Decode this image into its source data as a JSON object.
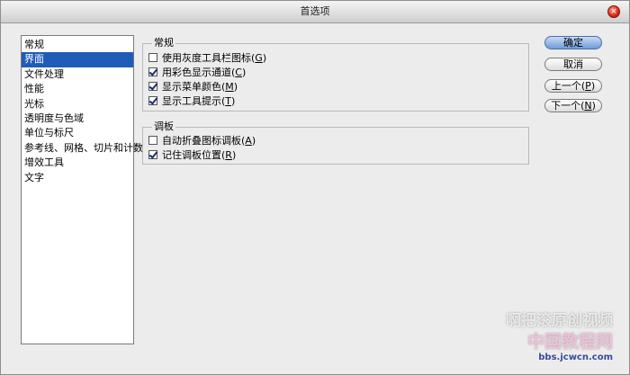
{
  "window": {
    "title": "首选项",
    "close_symbol": "×"
  },
  "categories": [
    {
      "label": "常规",
      "selected": false
    },
    {
      "label": "界面",
      "selected": true
    },
    {
      "label": "文件处理",
      "selected": false
    },
    {
      "label": "性能",
      "selected": false
    },
    {
      "label": "光标",
      "selected": false
    },
    {
      "label": "透明度与色域",
      "selected": false
    },
    {
      "label": "单位与标尺",
      "selected": false
    },
    {
      "label": "参考线、网格、切片和计数",
      "selected": false
    },
    {
      "label": "增效工具",
      "selected": false
    },
    {
      "label": "文字",
      "selected": false
    }
  ],
  "general_group": {
    "title": "常规",
    "options": [
      {
        "label": "使用灰度工具栏图标",
        "mnemonic": "G",
        "checked": false
      },
      {
        "label": "用彩色显示通道",
        "mnemonic": "C",
        "checked": true
      },
      {
        "label": "显示菜单颜色",
        "mnemonic": "M",
        "checked": true
      },
      {
        "label": "显示工具提示",
        "mnemonic": "T",
        "checked": true
      }
    ]
  },
  "panels_group": {
    "title": "调板",
    "options": [
      {
        "label": "自动折叠图标调板",
        "mnemonic": "A",
        "checked": false
      },
      {
        "label": "记住调板位置",
        "mnemonic": "R",
        "checked": true
      }
    ]
  },
  "buttons": {
    "ok": {
      "label": "确定"
    },
    "cancel": {
      "label": "取消"
    },
    "prev": {
      "label": "上一个",
      "mnemonic": "P"
    },
    "next": {
      "label": "下一个",
      "mnemonic": "N"
    }
  },
  "watermark": {
    "line1": "啊把滚原创视频",
    "line2": "中国教程网",
    "line3": "bbs.jcwcn.com"
  }
}
